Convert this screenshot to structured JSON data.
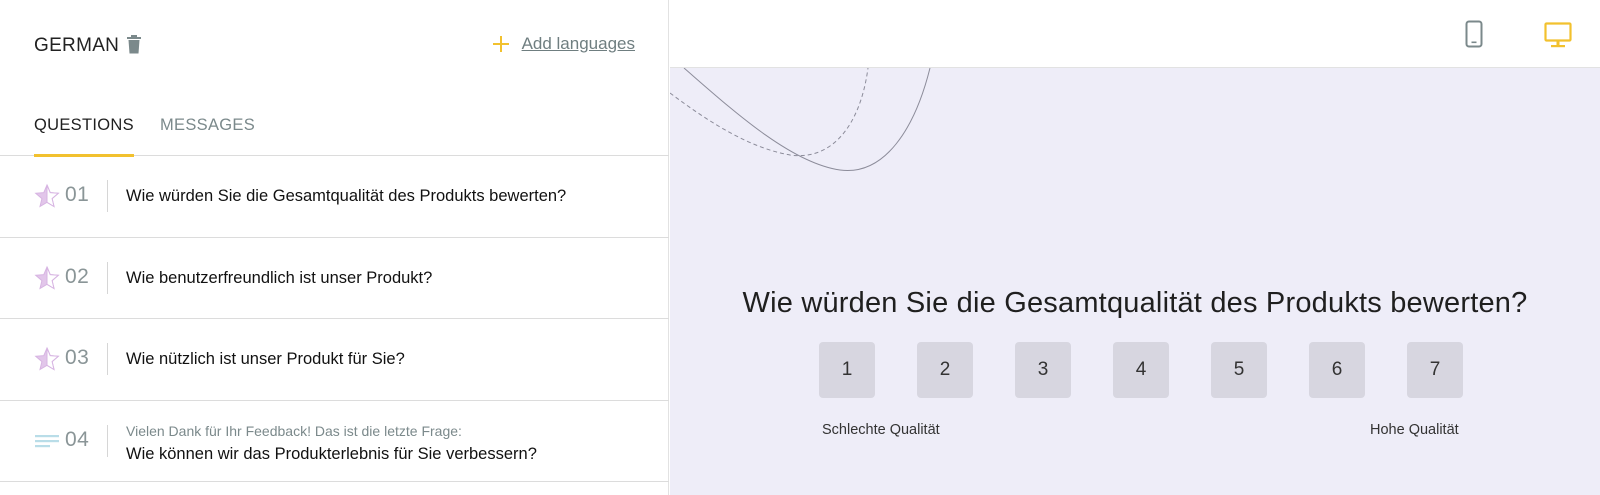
{
  "header": {
    "language": "GERMAN",
    "add_languages": "Add languages",
    "accent_color": "#f2c12e"
  },
  "tabs": [
    {
      "label": "QUESTIONS",
      "active": true
    },
    {
      "label": "MESSAGES",
      "active": false
    }
  ],
  "questions": [
    {
      "icon": "star-icon",
      "number": "01",
      "text": "Wie würden Sie die Gesamtqualität des Produkts bewerten?"
    },
    {
      "icon": "star-icon",
      "number": "02",
      "text": "Wie benutzerfreundlich ist unser Produkt?"
    },
    {
      "icon": "star-icon",
      "number": "03",
      "text": "Wie nützlich ist unser Produkt für Sie?"
    },
    {
      "icon": "text-lines-icon",
      "number": "04",
      "subtext": "Vielen Dank für Ihr Feedback! Das ist die letzte Frage:",
      "text": "Wie können wir das Produkterlebnis für Sie verbessern?"
    }
  ],
  "preview": {
    "device": "desktop",
    "question": "Wie würden Sie die Gesamtqualität des Produkts bewerten?",
    "scale": [
      "1",
      "2",
      "3",
      "4",
      "5",
      "6",
      "7"
    ],
    "low_label": "Schlechte Qualität",
    "high_label": "Hohe Qualität",
    "background_color": "#eeedf8"
  }
}
